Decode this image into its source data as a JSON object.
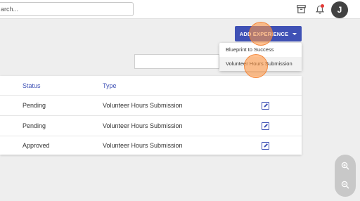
{
  "topbar": {
    "search_value": "arch...",
    "icons": [
      "archive-icon",
      "notification-bell-icon"
    ],
    "avatar_initial": "J",
    "notification_dot_color": "#e53935"
  },
  "actions": {
    "add_experience_label": "ADD EXPERIENCE",
    "add_experience_color": "#3f51b5"
  },
  "menu": {
    "items": [
      {
        "label": "Blueprint to Success"
      },
      {
        "label": "Volunteer Hours Submission"
      }
    ]
  },
  "table": {
    "headers": {
      "status": "Status",
      "type": "Type"
    },
    "rows": [
      {
        "status": "Pending",
        "type": "Volunteer Hours Submission"
      },
      {
        "status": "Pending",
        "type": "Volunteer Hours Submission"
      },
      {
        "status": "Approved",
        "type": "Volunteer Hours Submission"
      }
    ]
  },
  "zoom": {
    "in_icon": "zoom-in-icon",
    "out_icon": "zoom-out-icon"
  },
  "colors": {
    "accent": "#3f51b5",
    "tap_indicator": "#ff9846"
  }
}
